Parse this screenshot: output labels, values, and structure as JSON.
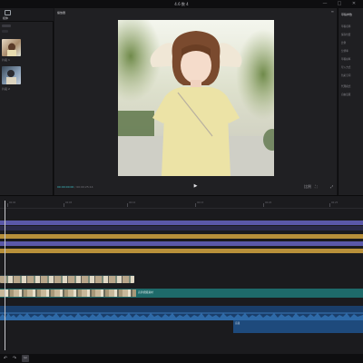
{
  "window": {
    "title": "4.6 数 4",
    "minimize": "—",
    "maximize": "□",
    "close": "✕"
  },
  "media": {
    "tab_label": "媒体",
    "clips": [
      {
        "label": "片段 1"
      },
      {
        "label": "片段 2"
      }
    ]
  },
  "preview": {
    "title": "播放器",
    "menu": "≡",
    "timecode_current": "00:00:00:00",
    "timecode_total": "00:00:25:14",
    "play_icon": "▶",
    "ratio_label": "比例",
    "fit_icon": "⛶",
    "fullscreen_icon": "⤢"
  },
  "details": {
    "title": "草稿参数",
    "rows": [
      "草稿名称",
      "保存位置",
      "比例",
      "分辨率",
      "草稿帧率",
      "导入方式",
      "色彩空间",
      "代理模式",
      "自由层级"
    ]
  },
  "timeline": {
    "ruler_labels": [
      "00:00",
      "00:05",
      "00:10",
      "00:15",
      "00:20",
      "00:25"
    ],
    "main_clip_label": "高清视频素材",
    "audio2_label": "音频"
  },
  "bottombar": {
    "undo_icon": "↶",
    "redo_icon": "↷",
    "tool_icon": "✂"
  },
  "colors": {
    "accent": "#3fc1c9",
    "purple_track": "#5a58a8",
    "gold_track": "#b8903a",
    "video_track": "#1e6a6a",
    "audio_track": "#1a3e6a"
  }
}
